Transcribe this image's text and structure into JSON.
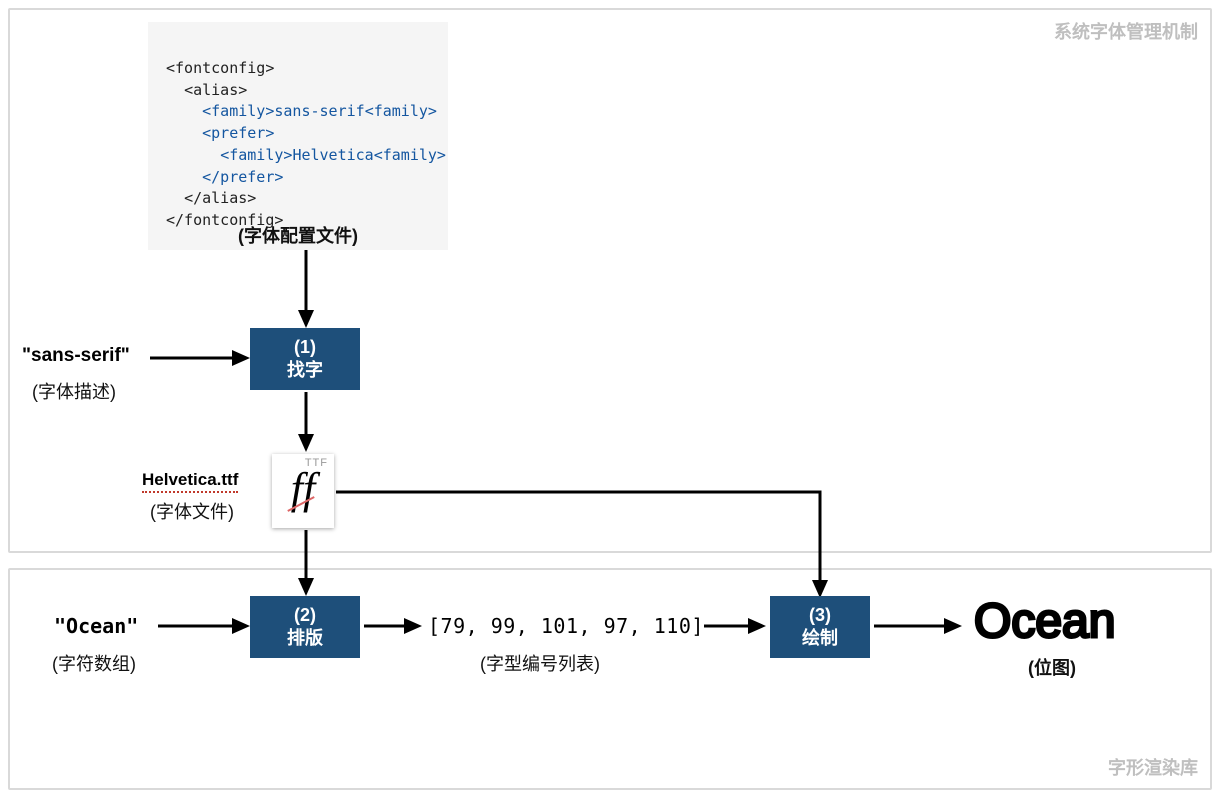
{
  "regions": {
    "top_label": "系统字体管理机制",
    "bottom_label": "字形渲染库"
  },
  "code": {
    "l1_open": "<fontconfig>",
    "l2_open": "<alias>",
    "l3a": "<family>",
    "l3t": "sans-serif",
    "l3b": "<family>",
    "l4_open": "<prefer>",
    "l5a": "<family>",
    "l5t": "Helvetica",
    "l5b": "<family>",
    "l6_close": "</prefer>",
    "l7_close": "</alias>",
    "l8_close": "</fontconfig>",
    "caption": "(字体配置文件)"
  },
  "step1": {
    "num": "(1)",
    "label": "找字"
  },
  "step2": {
    "num": "(2)",
    "label": "排版"
  },
  "step3": {
    "num": "(3)",
    "label": "绘制"
  },
  "inputs": {
    "font_desc_value": "\"sans-serif\"",
    "font_desc_caption": "(字体描述)",
    "chars_value": "\"Ocean\"",
    "chars_caption": "(字符数组)"
  },
  "fontfile": {
    "name": "Helvetica.ttf",
    "caption": "(字体文件)",
    "ttf_tag": "TTF",
    "ff": "ff"
  },
  "glyphs": {
    "list": "[79, 99, 101, 97, 110]",
    "caption": "(字型编号列表)"
  },
  "output": {
    "render": "Ocean",
    "caption": "(位图)"
  }
}
